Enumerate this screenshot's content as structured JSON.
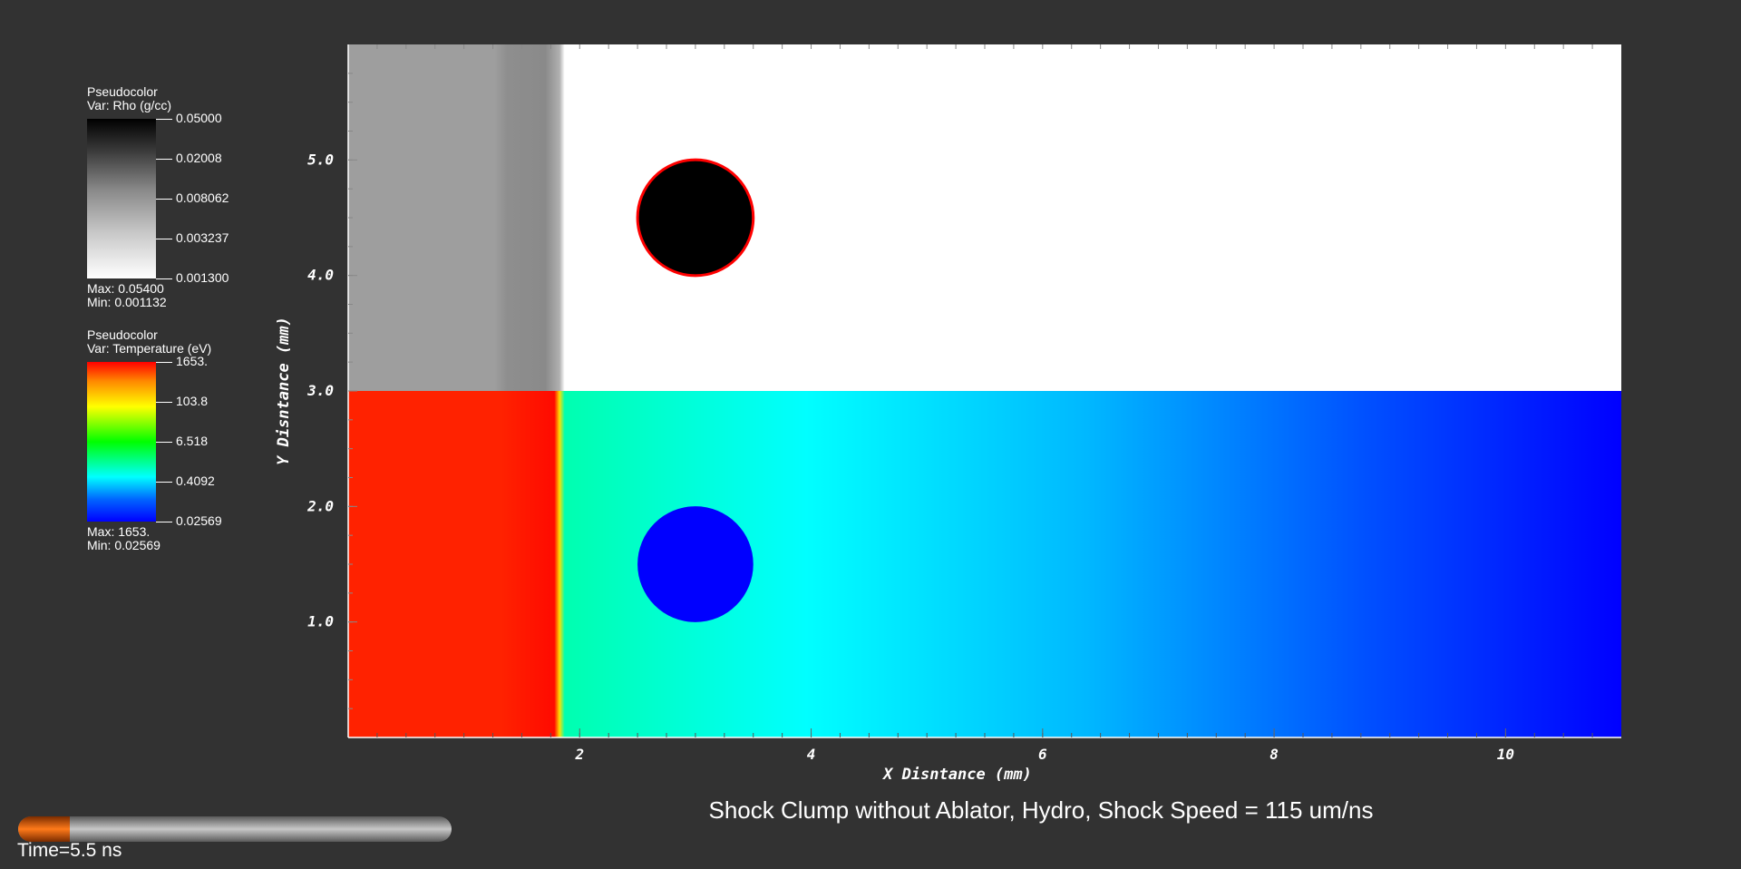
{
  "legend_rho": {
    "line1": "Pseudocolor",
    "line2": "Var: Rho (g/cc)",
    "ticks": [
      "0.05000",
      "0.02008",
      "0.008062",
      "0.003237",
      "0.001300"
    ],
    "max": "Max:  0.05400",
    "min": "Min:  0.001132"
  },
  "legend_temp": {
    "line1": "Pseudocolor",
    "line2": "Var: Temperature (eV)",
    "ticks": [
      "1653.",
      "103.8",
      "6.518",
      "0.4092",
      "0.02569"
    ],
    "max": "Max:  1653.",
    "min": "Min:  0.02569"
  },
  "chart_data": {
    "type": "heatmap",
    "title": "",
    "xlabel": "X Disntance (mm)",
    "ylabel": "Y Disntance (mm)",
    "xlim": [
      0,
      11
    ],
    "ylim": [
      0,
      6
    ],
    "xticks": [
      2,
      4,
      6,
      8,
      10
    ],
    "yticks": [
      1.0,
      2.0,
      3.0,
      4.0,
      5.0
    ],
    "xtick_labels": [
      "2",
      "4",
      "6",
      "8",
      "10"
    ],
    "ytick_labels": [
      "1.0",
      "2.0",
      "3.0",
      "4.0",
      "5.0"
    ],
    "shock_front_x": 1.85,
    "panels": [
      {
        "variable": "Rho",
        "y_range": [
          3,
          6
        ],
        "clump": {
          "cx": 3.0,
          "cy": 4.5,
          "r": 0.5
        }
      },
      {
        "variable": "Temperature",
        "y_range": [
          0,
          3
        ],
        "clump": {
          "cx": 3.0,
          "cy": 1.5,
          "r": 0.5
        }
      }
    ]
  },
  "caption": "Shock Clump without Ablator, Hydro, Shock Speed = 115 um/ns",
  "time": {
    "label": "Time=5.5 ns",
    "progress": 0.12
  },
  "colors": {
    "background": "#323232",
    "clump_outline": "#ff0000",
    "hot_region": "#ff2200"
  }
}
